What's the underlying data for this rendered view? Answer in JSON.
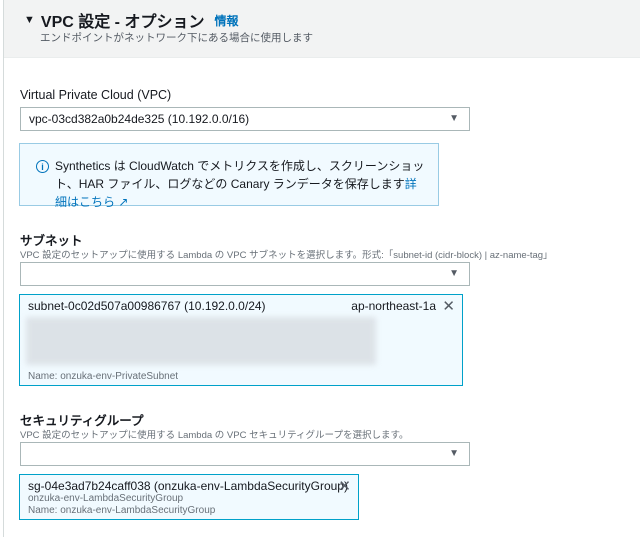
{
  "section": {
    "title": "VPC 設定 - オプション",
    "info_link": "情報",
    "subtitle": "エンドポイントがネットワーク下にある場合に使用します"
  },
  "vpc": {
    "label": "Virtual Private Cloud (VPC)",
    "value": "vpc-03cd382a0b24de325 (10.192.0.0/16)"
  },
  "alert": {
    "text": "Synthetics は CloudWatch でメトリクスを作成し、スクリーンショット、HAR ファイル、ログなどの Canary ランデータを保存します",
    "link": "詳細はこちら"
  },
  "subnet": {
    "label": "サブネット",
    "description": "VPC 設定のセットアップに使用する Lambda の VPC サブネットを選択します。形式:「subnet-id (cidr-block) | az-name-tag」",
    "value": "",
    "token": {
      "id": "subnet-0c02d507a00986767 (10.192.0.0/24)",
      "az": "ap-northeast-1a",
      "name": "Name: onzuka-env-PrivateSubnet"
    }
  },
  "security_group": {
    "label": "セキュリティグループ",
    "description": "VPC 設定のセットアップに使用する Lambda の VPC セキュリティグループを選択します。",
    "value": "",
    "token": {
      "id": "sg-04e3ad7b24caff038 (onzuka-env-LambdaSecurityGroup)",
      "line2": "onzuka-env-LambdaSecurityGroup",
      "name": "Name: onzuka-env-LambdaSecurityGroup"
    }
  }
}
